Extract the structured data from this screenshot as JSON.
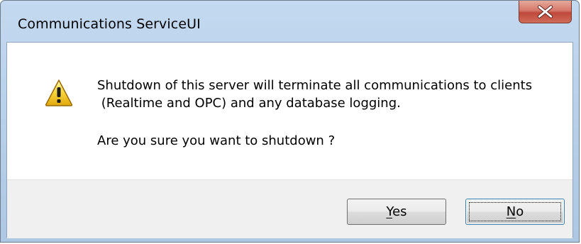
{
  "window": {
    "title": "Communications ServiceUI"
  },
  "message": {
    "icon": "warning-icon",
    "line1": "Shutdown of this server will terminate all communications to clients",
    "line2": " (Realtime and OPC) and any database logging.",
    "question": "Are you sure you want to shutdown ?"
  },
  "buttons": {
    "yes": {
      "mnemonic": "Y",
      "rest": "es"
    },
    "no": {
      "mnemonic": "N",
      "rest": "o"
    }
  },
  "colors": {
    "close_button": "#c0483a",
    "titlebar": "#b9d1ea",
    "footer": "#f0f0f0"
  }
}
